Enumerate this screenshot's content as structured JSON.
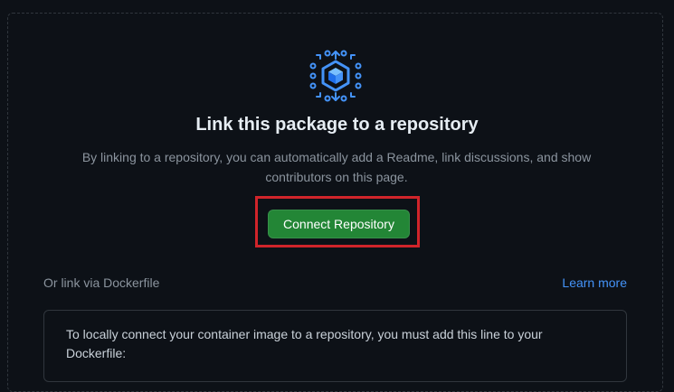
{
  "empty_state": {
    "icon": "package-link-icon",
    "title": "Link this package to a repository",
    "description": "By linking to a repository, you can automatically add a Readme, link discussions, and show contributors on this page.",
    "connect_button": "Connect Repository"
  },
  "dockerfile": {
    "label": "Or link via Dockerfile",
    "learn_more": "Learn more",
    "info": "To locally connect your container image to a repository, you must add this line to your Dockerfile:"
  },
  "colors": {
    "background": "#0d1117",
    "button": "#238636",
    "link": "#4493f8",
    "highlight": "#d0242a"
  }
}
